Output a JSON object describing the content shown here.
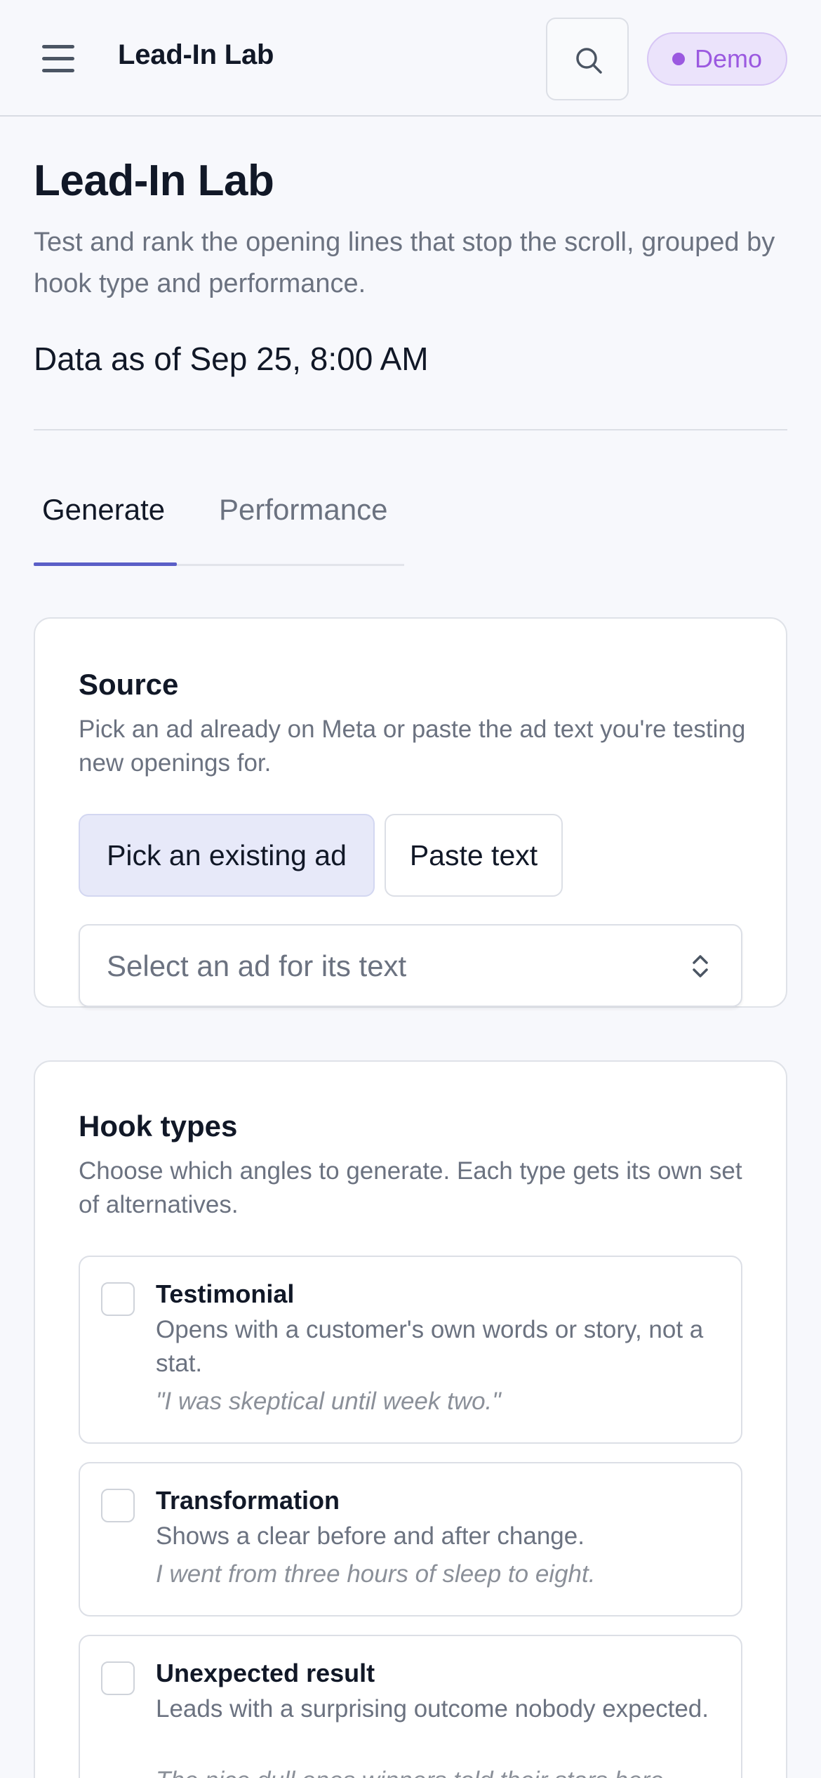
{
  "header": {
    "app_title": "Lead-In Lab",
    "menu_icon": "hamburger-menu-icon",
    "search_icon": "search-icon",
    "badge_label": "Demo"
  },
  "intro": {
    "title": "Lead-In Lab",
    "subtitle": "Test and rank the opening lines that stop the scroll, grouped by hook type and performance.",
    "data_as_of": "Data as of Sep 25, 8:00 AM"
  },
  "tabs": [
    {
      "label": "Generate",
      "active": true
    },
    {
      "label": "Performance",
      "active": false
    }
  ],
  "source": {
    "heading": "Source",
    "description": "Pick an ad already on Meta or paste the ad text you're testing new openings for.",
    "options": [
      {
        "label": "Pick an existing ad",
        "selected": true
      },
      {
        "label": "Paste text",
        "selected": false
      }
    ],
    "select_placeholder": "Select an ad for its text"
  },
  "hooks": {
    "heading": "Hook types",
    "description": "Choose which angles to generate. Each type gets its own set of alternatives.",
    "items": [
      {
        "title": "Testimonial",
        "description": "Opens with a customer's own words or story, not a stat.",
        "example": "\"I was skeptical until week two.\"",
        "checked": false
      },
      {
        "title": "Transformation",
        "description": "Shows a clear before and after change.",
        "example": "I went from three hours of sleep to eight.",
        "checked": false
      },
      {
        "title": "Unexpected result",
        "description": "Leads with a surprising outcome nobody expected.",
        "example": "The nice dull ones winners told their stars here",
        "checked": false
      }
    ]
  },
  "colors": {
    "accent": "#5b5fc7",
    "badge_text": "#9b59e0",
    "badge_bg": "#ebe3fb",
    "background": "#f7f8fc"
  }
}
